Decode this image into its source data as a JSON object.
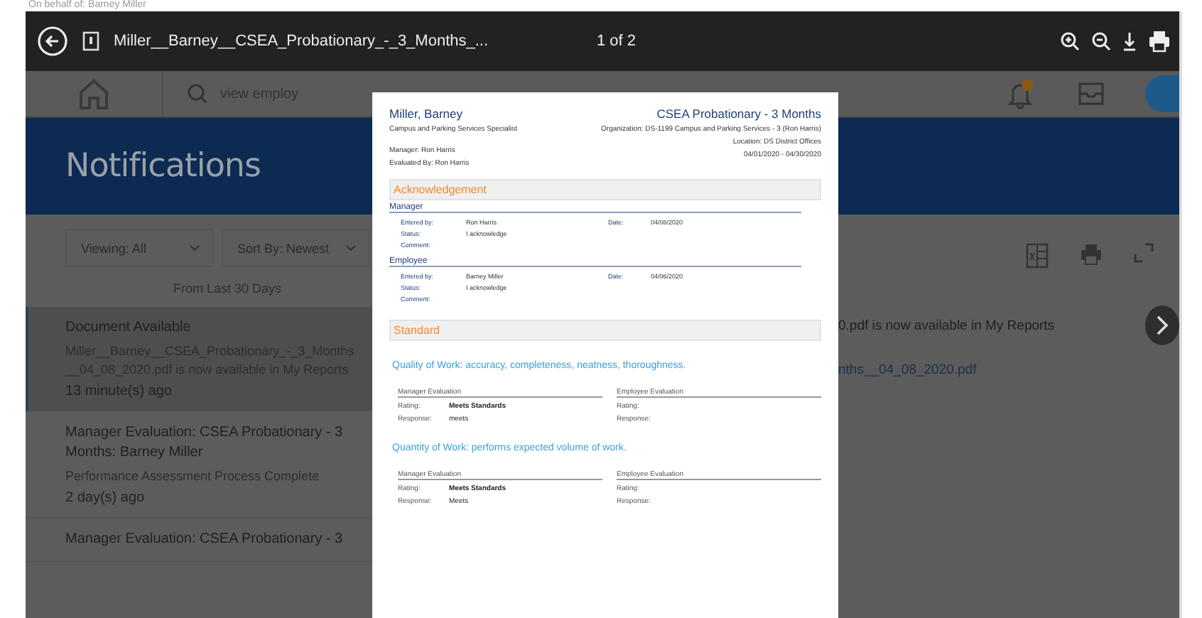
{
  "on_behalf": "On behalf of: Barney Miller",
  "viewer": {
    "file_name": "Miller__Barney__CSEA_Probationary_-_3_Months_...",
    "page_indicator": "1 of 2"
  },
  "header": {
    "search_value": "view employ"
  },
  "title": "Notifications",
  "filters": [
    {
      "label": "Viewing: All"
    },
    {
      "label": "Sort By: Newest"
    }
  ],
  "range": "From Last 30 Days",
  "notifications": [
    {
      "title": "Document Available",
      "body": "Miller__Barney__CSEA_Probationary_-_3_Months__04_08_2020.pdf is now available in My Reports",
      "time": "13 minute(s) ago",
      "selected": true
    },
    {
      "title": "Manager Evaluation: CSEA Probationary - 3 Months: Barney Miller",
      "body": "Performance Assessment Process Complete",
      "time": "2 day(s) ago",
      "selected": false
    },
    {
      "title": "Manager Evaluation: CSEA Probationary - 3",
      "selected": false
    }
  ],
  "detail": {
    "message": "0.pdf is now available in My Reports",
    "link": "nths__04_08_2020.pdf"
  },
  "document": {
    "name": "Miller, Barney",
    "position": "Campus and Parking Services Specialist",
    "manager": "Manager: Ron Harris",
    "evaluated_by": "Evaluated By: Ron Harris",
    "form": "CSEA Probationary - 3 Months",
    "organization": "Organization: DS-1199 Campus and Parking Services - 3 (Ron Harris)",
    "location": "Location: DS District Offices",
    "period": "04/01/2020 - 04/30/2020",
    "acknowledgement": {
      "heading": "Acknowledgement",
      "groups": [
        {
          "heading": "Manager",
          "entered_label": "Entered by:",
          "entered_by": "Ron Harris",
          "date_label": "Date:",
          "date": "04/08/2020",
          "status_label": "Status:",
          "status": "I acknowledge",
          "comment_label": "Comment:"
        },
        {
          "heading": "Employee",
          "entered_label": "Entered by:",
          "entered_by": "Barney Miller",
          "date_label": "Date:",
          "date": "04/06/2020",
          "status_label": "Status:",
          "status": "I acknowledge",
          "comment_label": "Comment:"
        }
      ]
    },
    "standard": {
      "heading": "Standard",
      "items": [
        {
          "title": "Quality of Work: accuracy, completeness, neatness, thoroughness.",
          "manager": {
            "heading": "Manager Evaluation",
            "rating_label": "Rating:",
            "rating": "Meets Standards",
            "response_label": "Response:",
            "response": "meets"
          },
          "employee": {
            "heading": "Employee Evaluation",
            "rating_label": "Rating:",
            "response_label": "Response:"
          }
        },
        {
          "title": "Quantity of Work:  performs expected volume of work.",
          "manager": {
            "heading": "Manager Evaluation",
            "rating_label": "Rating:",
            "rating": "Meets Standards",
            "response_label": "Response:",
            "response": "Meets"
          },
          "employee": {
            "heading": "Employee Evaluation",
            "rating_label": "Rating:",
            "response_label": "Response:"
          }
        }
      ]
    }
  }
}
